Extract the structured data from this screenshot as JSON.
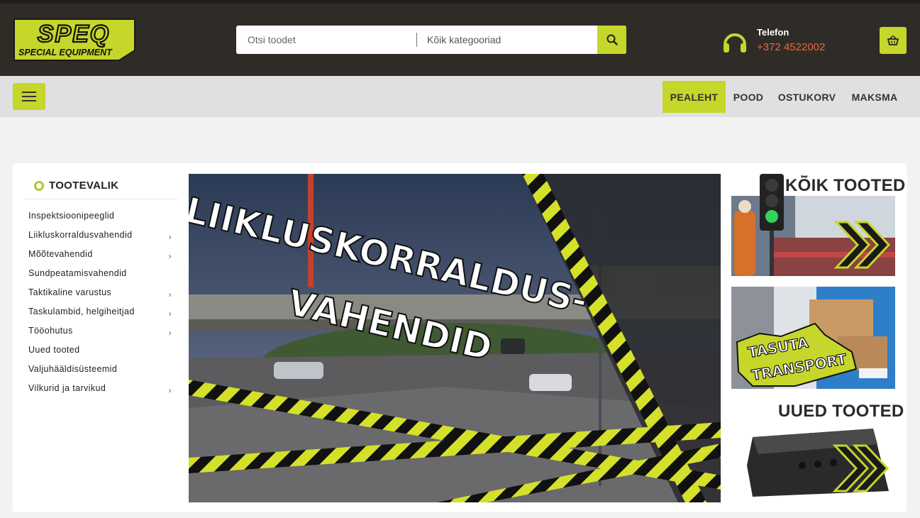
{
  "header": {
    "logo_text_main": "SPEQ",
    "logo_text_sub": "SPECIAL EQUIPMENT",
    "search_placeholder": "Otsi toodet",
    "category_select": "Kõik kategooriad",
    "phone_label": "Telefon",
    "phone_number": "+372 4522002"
  },
  "nav": {
    "items": [
      {
        "label": "PEALEHT",
        "active": true
      },
      {
        "label": "POOD",
        "active": false
      },
      {
        "label": "OSTUKORV",
        "active": false
      },
      {
        "label": "MAKSMA",
        "active": false
      }
    ]
  },
  "sidebar": {
    "title": "TOOTEVALIK",
    "items": [
      {
        "label": "Inspektsioonipeeglid",
        "has_children": false
      },
      {
        "label": "Liikluskorraldusvahendid",
        "has_children": true
      },
      {
        "label": "Mõõtevahendid",
        "has_children": true
      },
      {
        "label": "Sundpeatamisvahendid",
        "has_children": false
      },
      {
        "label": "Taktikaline varustus",
        "has_children": true
      },
      {
        "label": "Taskulambid, helgiheitjad",
        "has_children": true
      },
      {
        "label": "Tööohutus",
        "has_children": true
      },
      {
        "label": "Uued tooted",
        "has_children": false
      },
      {
        "label": "Valjuhääldisüsteemid",
        "has_children": false
      },
      {
        "label": "Vilkurid ja tarvikud",
        "has_children": true
      }
    ]
  },
  "hero": {
    "line1": "LIIKLUSKORRALDUS-",
    "line2": "VAHENDID"
  },
  "promos": {
    "all_products_title": "KÕIK TOOTED",
    "free_shipping_line1": "TASUTA",
    "free_shipping_line2": "TRANSPORT",
    "new_products_title": "UUED TOOTED"
  },
  "colors": {
    "accent": "#c6d62a",
    "header_bg": "#2f2c28",
    "phone": "#e8683a"
  }
}
